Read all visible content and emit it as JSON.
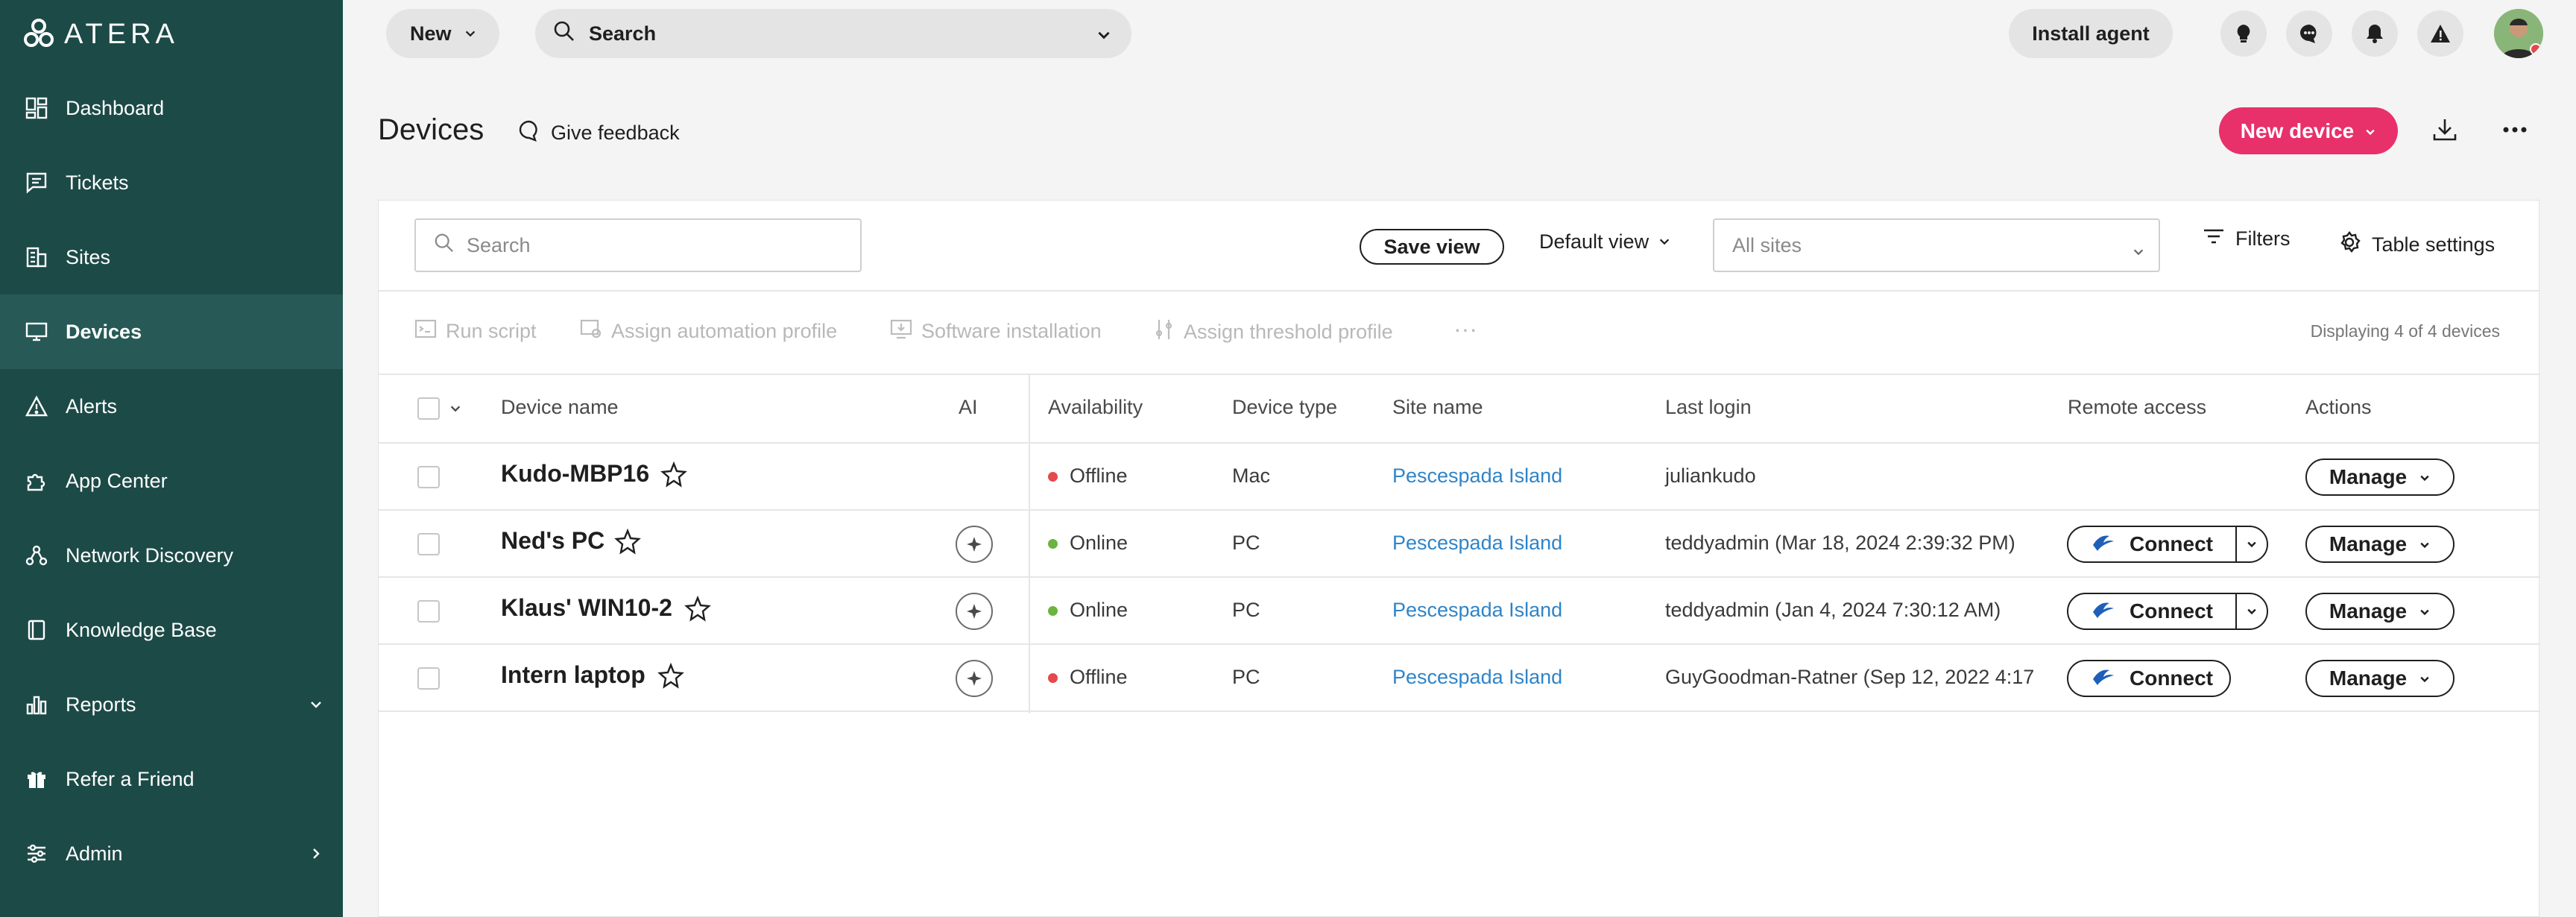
{
  "brand": {
    "logo_text": "ATERA"
  },
  "sidebar": {
    "items": [
      {
        "label": "Dashboard",
        "icon": "dashboard-icon"
      },
      {
        "label": "Tickets",
        "icon": "tickets-icon"
      },
      {
        "label": "Sites",
        "icon": "sites-icon"
      },
      {
        "label": "Devices",
        "icon": "devices-icon",
        "active": true
      },
      {
        "label": "Alerts",
        "icon": "alert-triangle-icon"
      },
      {
        "label": "App Center",
        "icon": "puzzle-icon"
      },
      {
        "label": "Network Discovery",
        "icon": "network-icon"
      },
      {
        "label": "Knowledge Base",
        "icon": "book-icon"
      },
      {
        "label": "Reports",
        "icon": "bar-chart-icon"
      },
      {
        "label": "Refer a Friend",
        "icon": "gift-icon"
      },
      {
        "label": "Admin",
        "icon": "sliders-icon"
      }
    ]
  },
  "topbar": {
    "new_label": "New",
    "search_label": "Search",
    "install_agent_label": "Install agent"
  },
  "header": {
    "title": "Devices",
    "feedback_label": "Give feedback",
    "new_device_label": "New device"
  },
  "toolbar": {
    "search_placeholder": "Search",
    "save_view_label": "Save view",
    "default_view_label": "Default view",
    "sites_placeholder": "All sites",
    "filters_label": "Filters",
    "table_settings_label": "Table settings"
  },
  "actions": {
    "run_script": "Run script",
    "assign_automation": "Assign automation profile",
    "software_installation": "Software installation",
    "assign_threshold": "Assign threshold profile",
    "more": "···",
    "displaying": "Displaying 4 of 4 devices"
  },
  "table": {
    "headers": {
      "device_name": "Device name",
      "ai": "AI",
      "availability": "Availability",
      "device_type": "Device type",
      "site_name": "Site name",
      "last_login": "Last login",
      "remote_access": "Remote access",
      "actions": "Actions"
    },
    "rows": [
      {
        "name": "Kudo-MBP16",
        "availability": "Offline",
        "type": "Mac",
        "site": "Pescespada Island",
        "last_login": "juliankudo",
        "connect": "",
        "manage": "Manage"
      },
      {
        "name": "Ned's PC",
        "availability": "Online",
        "type": "PC",
        "site": "Pescespada Island",
        "last_login": "teddyadmin (Mar 18, 2024 2:39:32 PM)",
        "connect": "Connect",
        "manage": "Manage"
      },
      {
        "name": "Klaus' WIN10-2",
        "availability": "Online",
        "type": "PC",
        "site": "Pescespada Island",
        "last_login": "teddyadmin (Jan 4, 2024 7:30:12 AM)",
        "connect": "Connect",
        "manage": "Manage"
      },
      {
        "name": "Intern laptop",
        "availability": "Offline",
        "type": "PC",
        "site": "Pescespada Island",
        "last_login": "GuyGoodman-Ratner (Sep 12, 2022 4:17",
        "connect": "Connect",
        "manage": "Manage"
      }
    ]
  },
  "colors": {
    "sidebar_bg": "#1c4a47",
    "accent": "#e8306a",
    "online": "#6cb33f",
    "offline": "#e5484d",
    "link": "#2f84c8"
  }
}
